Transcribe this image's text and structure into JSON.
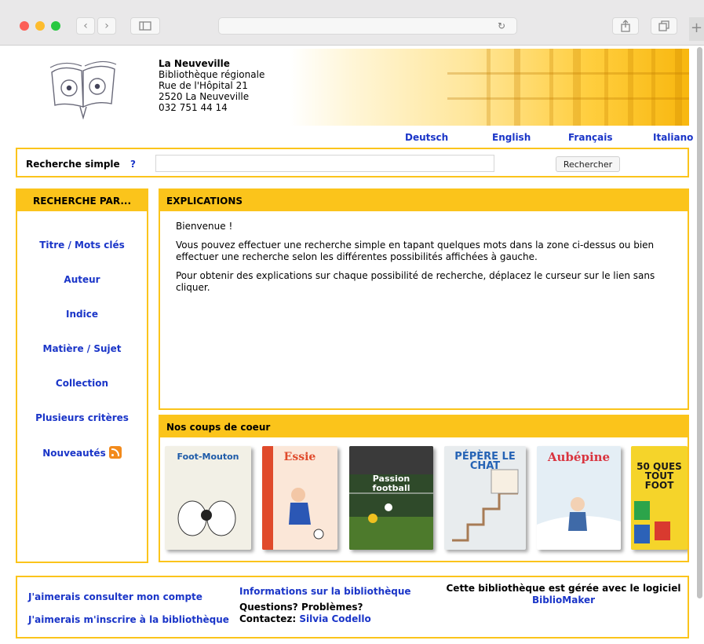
{
  "library": {
    "name": "La Neuveville",
    "type": "Bibliothèque régionale",
    "street": "Rue de l'Hôpital 21",
    "city": "2520 La Neuveville",
    "phone": "032 751 44 14"
  },
  "languages": [
    "Deutsch",
    "English",
    "Français",
    "Italiano"
  ],
  "search": {
    "label": "Recherche simple",
    "help": "?",
    "value": "",
    "button": "Rechercher"
  },
  "sidebar": {
    "title": "RECHERCHE PAR...",
    "items": [
      {
        "label": "Titre / Mots clés"
      },
      {
        "label": "Auteur"
      },
      {
        "label": "Indice"
      },
      {
        "label": "Matière / Sujet"
      },
      {
        "label": "Collection"
      },
      {
        "label": "Plusieurs critères"
      },
      {
        "label": "Nouveautés",
        "icon": "rss-icon"
      }
    ]
  },
  "explications": {
    "title": "EXPLICATIONS",
    "welcome": "Bienvenue !",
    "p1": "Vous pouvez effectuer une recherche simple en tapant quelques mots dans la zone ci-dessus ou bien effectuer une recherche selon les différentes possibilités affichées à gauche.",
    "p2": "Pour obtenir des explications sur chaque possibilité de recherche, déplacez le curseur sur le lien sans cliquer."
  },
  "coups": {
    "title": "Nos coups de coeur",
    "books": [
      {
        "title": "Foot-Mouton",
        "color": "#f2f0e6"
      },
      {
        "title": "Essie",
        "color": "#fbe7d8"
      },
      {
        "title": "Passion football",
        "color": "#2f4a2a"
      },
      {
        "title": "PÉPÈRE LE CHAT",
        "color": "#e8ecee"
      },
      {
        "title": "Aubépine",
        "color": "#e4eef5"
      },
      {
        "title": "50 QUES TOUT FOOT",
        "color": "#f5d42a"
      }
    ]
  },
  "footer": {
    "account": "J'aimerais consulter mon compte",
    "register": "J'aimerais m'inscrire à la bibliothèque",
    "info": "Informations sur la bibliothèque",
    "questions": "Questions? Problèmes?",
    "contact_prefix": "Contactez:",
    "contact_name": "Silvia Codello",
    "software_text": "Cette bibliothèque est gérée avec le logiciel",
    "software_link": "BiblioMaker"
  },
  "colors": {
    "accent": "#fbc41b",
    "link": "#1a35c8"
  }
}
